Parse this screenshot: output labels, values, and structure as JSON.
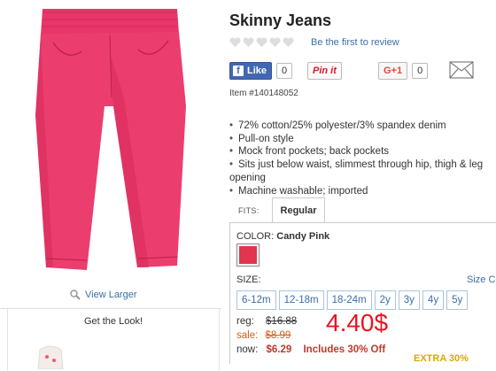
{
  "product": {
    "title": "Skinny Jeans",
    "review_link": "Be the first to review",
    "item_number": "Item #140148052",
    "view_larger": "View Larger",
    "color_hex": "#e83b68"
  },
  "social": {
    "like_label": "Like",
    "like_count": "0",
    "pin_label": "Pin it",
    "gplus_label": "G+1",
    "gplus_count": "0"
  },
  "features": [
    "72% cotton/25% polyester/3% spandex denim",
    "Pull-on style",
    "Mock front pockets; back pockets",
    "Sits just below waist, slimmest through hip, thigh & leg",
    "opening",
    "Machine washable; imported"
  ],
  "fit": {
    "label": "FITS:",
    "selected": "Regular"
  },
  "color": {
    "label": "COLOR:",
    "value": "Candy Pink",
    "swatch_hex": "#e0344f"
  },
  "size": {
    "label": "SIZE:",
    "chart_link": "Size Ch",
    "options": [
      "6-12m",
      "12-18m",
      "18-24m",
      "2y",
      "3y",
      "4y",
      "5y"
    ]
  },
  "price": {
    "reg_label": "reg:",
    "reg_value": "$16.88",
    "sale_label": "sale:",
    "sale_value": "$8.99",
    "now_label": "now:",
    "now_value": "$6.29",
    "includes": "Includes 30% Off",
    "overlay": "4.40$",
    "extra": "EXTRA 30%"
  },
  "sidebar": {
    "get_the_look": "Get the Look!"
  }
}
